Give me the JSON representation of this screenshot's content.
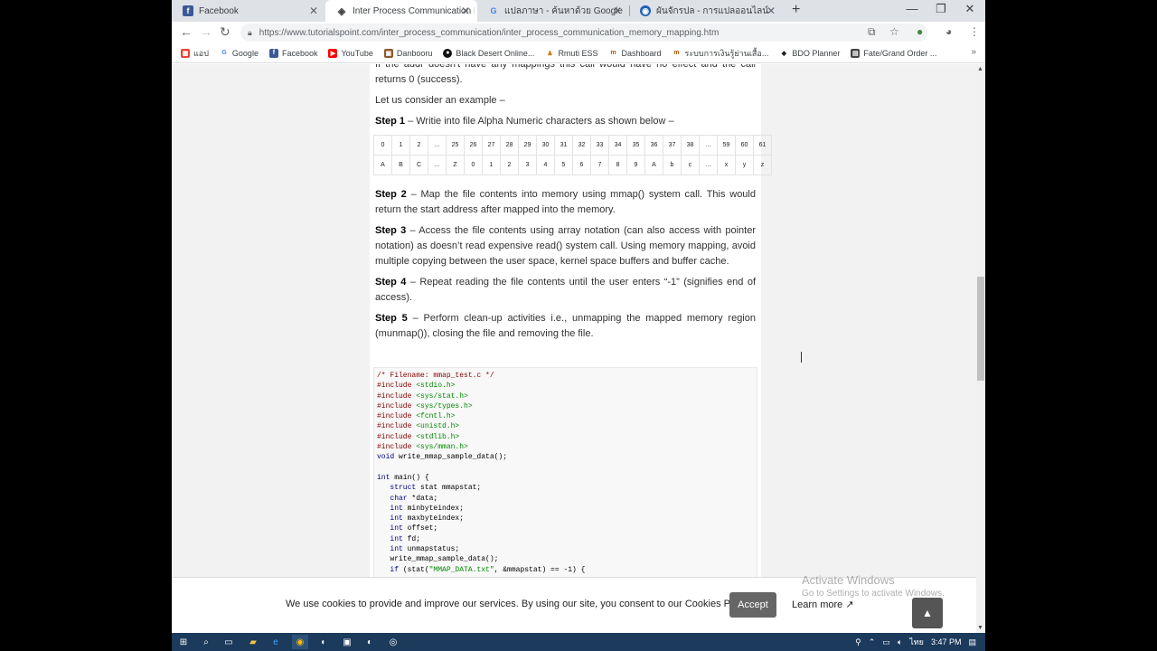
{
  "tabs": [
    {
      "label": "Facebook",
      "icon": "facebook-icon",
      "color": "#3b5998",
      "glyph": "f"
    },
    {
      "label": "Inter Process Communication Me",
      "icon": "tutorialspoint-icon",
      "color": "#555555",
      "glyph": "◈"
    },
    {
      "label": "แปลภาษา - ค้นหาด้วย Google",
      "icon": "google-icon",
      "color": "#4285f4",
      "glyph": "G"
    },
    {
      "label": "ผันจักรปล - การแปลออนไลน์",
      "icon": "translate-icon",
      "color": "#1a5fb4",
      "glyph": "◉"
    }
  ],
  "url": "https://www.tutorialspoint.com/inter_process_communication/inter_process_communication_memory_mapping.htm",
  "bookmarks": [
    {
      "label": "แอป",
      "icon": "apps-icon",
      "color": "#ea4335"
    },
    {
      "label": "Google",
      "icon": "google-icon",
      "color": "#4285f4"
    },
    {
      "label": "Facebook",
      "icon": "facebook-icon",
      "color": "#3b5998"
    },
    {
      "label": "YouTube",
      "icon": "youtube-icon",
      "color": "#ff0000"
    },
    {
      "label": "Danbooru",
      "icon": "danbooru-icon",
      "color": "#8b5a2b"
    },
    {
      "label": "Black Desert Online...",
      "icon": "blackdesert-icon",
      "color": "#111111"
    },
    {
      "label": "Rmuti ESS",
      "icon": "rmuti-icon",
      "color": "#d97706"
    },
    {
      "label": "Dashboard",
      "icon": "dashboard-icon",
      "color": "#b45309"
    },
    {
      "label": "ระบบการเงินรู้ย่านเสื้อ...",
      "icon": "finance-icon",
      "color": "#b45309"
    },
    {
      "label": "BDO Planner",
      "icon": "bdo-icon",
      "color": "#222222"
    },
    {
      "label": "Fate/Grand Order ...",
      "icon": "fgo-icon",
      "color": "#444444"
    }
  ],
  "content": {
    "partial_line": "If the addr doesn't have any mappings this call would have no effect and the call returns 0 (success).",
    "example_intro": "Let us consider an example –",
    "steps": [
      {
        "label": "Step 1",
        "text": " – Writie into file Alpha Numeric characters as shown below –"
      },
      {
        "label": "Step 2",
        "text": " – Map the file contents into memory using mmap() system call. This would return the start address after mapped into the memory."
      },
      {
        "label": "Step 3",
        "text": " – Access the file contents using array notation (can also access with pointer notation) as doesn’t read expensive read() system call. Using memory mapping, avoid multiple copying between the user space, kernel space buffers and buffer cache."
      },
      {
        "label": "Step 4",
        "text": " – Repeat reading the file contents until the user enters “-1” (signifies end of access)."
      },
      {
        "label": "Step 5",
        "text": " – Perform clean-up activities i.e., unmapping the mapped memory region (munmap()), closing the file and removing the file."
      }
    ],
    "table_indices": [
      "0",
      "1",
      "2",
      "...",
      "25",
      "26",
      "27",
      "28",
      "29",
      "30",
      "31",
      "32",
      "33",
      "34",
      "35",
      "36",
      "37",
      "38",
      "...",
      "59",
      "60",
      "61"
    ],
    "table_chars": [
      "A",
      "B",
      "C",
      "...",
      "Z",
      "0",
      "1",
      "2",
      "3",
      "4",
      "5",
      "6",
      "7",
      "8",
      "9",
      "A",
      "b",
      "c",
      "...",
      "x",
      "y",
      "z"
    ],
    "code_lines": [
      [
        {
          "t": "/* Filename: mmap_test.c */",
          "c": "c-com"
        }
      ],
      [
        {
          "t": "#include ",
          "c": "c-pre"
        },
        {
          "t": "<stdio.h>",
          "c": "c-str"
        }
      ],
      [
        {
          "t": "#include ",
          "c": "c-pre"
        },
        {
          "t": "<sys/stat.h>",
          "c": "c-str"
        }
      ],
      [
        {
          "t": "#include ",
          "c": "c-pre"
        },
        {
          "t": "<sys/types.h>",
          "c": "c-str"
        }
      ],
      [
        {
          "t": "#include ",
          "c": "c-pre"
        },
        {
          "t": "<fcntl.h>",
          "c": "c-str"
        }
      ],
      [
        {
          "t": "#include ",
          "c": "c-pre"
        },
        {
          "t": "<unistd.h>",
          "c": "c-str"
        }
      ],
      [
        {
          "t": "#include ",
          "c": "c-pre"
        },
        {
          "t": "<stdlib.h>",
          "c": "c-str"
        }
      ],
      [
        {
          "t": "#include ",
          "c": "c-pre"
        },
        {
          "t": "<sys/mman.h>",
          "c": "c-str"
        }
      ],
      [
        {
          "t": "void",
          "c": "c-kw"
        },
        {
          "t": " write_mmap_sample_data();",
          "c": ""
        }
      ],
      [
        {
          "t": "",
          "c": ""
        }
      ],
      [
        {
          "t": "int",
          "c": "c-kw"
        },
        {
          "t": " main() {",
          "c": ""
        }
      ],
      [
        {
          "t": "   struct",
          "c": "c-kw"
        },
        {
          "t": " stat mmapstat;",
          "c": ""
        }
      ],
      [
        {
          "t": "   char",
          "c": "c-kw"
        },
        {
          "t": " *data;",
          "c": ""
        }
      ],
      [
        {
          "t": "   int",
          "c": "c-kw"
        },
        {
          "t": " minbyteindex;",
          "c": ""
        }
      ],
      [
        {
          "t": "   int",
          "c": "c-kw"
        },
        {
          "t": " maxbyteindex;",
          "c": ""
        }
      ],
      [
        {
          "t": "   int",
          "c": "c-kw"
        },
        {
          "t": " offset;",
          "c": ""
        }
      ],
      [
        {
          "t": "   int",
          "c": "c-kw"
        },
        {
          "t": " fd;",
          "c": ""
        }
      ],
      [
        {
          "t": "   int",
          "c": "c-kw"
        },
        {
          "t": " unmapstatus;",
          "c": ""
        }
      ],
      [
        {
          "t": "   write_mmap_sample_data();",
          "c": ""
        }
      ],
      [
        {
          "t": "   if",
          "c": "c-kw"
        },
        {
          "t": " (stat(",
          "c": ""
        },
        {
          "t": "\"MMAP_DATA.txt\"",
          "c": "c-str"
        },
        {
          "t": ", &mmapstat) == -1) {",
          "c": ""
        }
      ]
    ]
  },
  "cookie": {
    "text": "We use cookies to provide and improve our services. By using our site, you consent to our Cookies Policy.",
    "accept": "Accept",
    "learn_more": "Learn more"
  },
  "watermark": {
    "line1": "Activate Windows",
    "line2": "Go to Settings to activate Windows."
  },
  "taskbar": {
    "lang": "ไทย",
    "time": "3:47 PM"
  }
}
